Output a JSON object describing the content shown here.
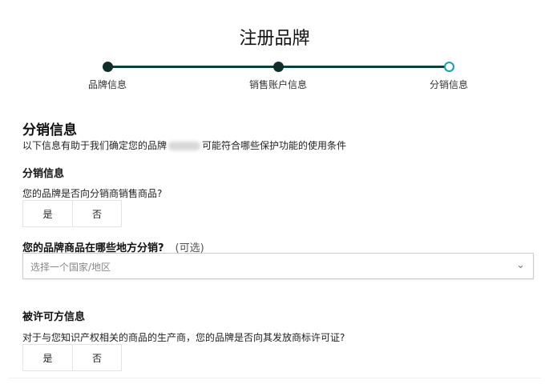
{
  "page": {
    "title": "注册品牌"
  },
  "stepper": {
    "steps": [
      {
        "label": "品牌信息",
        "state": "done"
      },
      {
        "label": "销售账户信息",
        "state": "done"
      },
      {
        "label": "分销信息",
        "state": "current"
      }
    ]
  },
  "section": {
    "heading": "分销信息",
    "description_before": "以下信息有助于我们确定您的品牌",
    "description_after": "可能符合哪些保护功能的使用条件"
  },
  "distribution": {
    "heading": "分销信息",
    "question": "您的品牌是否向分销商销售商品?",
    "yes": "是",
    "no": "否"
  },
  "regions": {
    "label": "您的品牌商品在哪些地方分销?",
    "optional": "(可选)",
    "placeholder": "选择一个国家/地区"
  },
  "licensee": {
    "heading": "被许可方信息",
    "question": "对于与您知识产权相关的商品的生产商，您的品牌是否向其发放商标许可证?",
    "yes": "是",
    "no": "否"
  },
  "colors": {
    "step_done": "#0f2e2b",
    "step_current": "#1aa0a8"
  }
}
